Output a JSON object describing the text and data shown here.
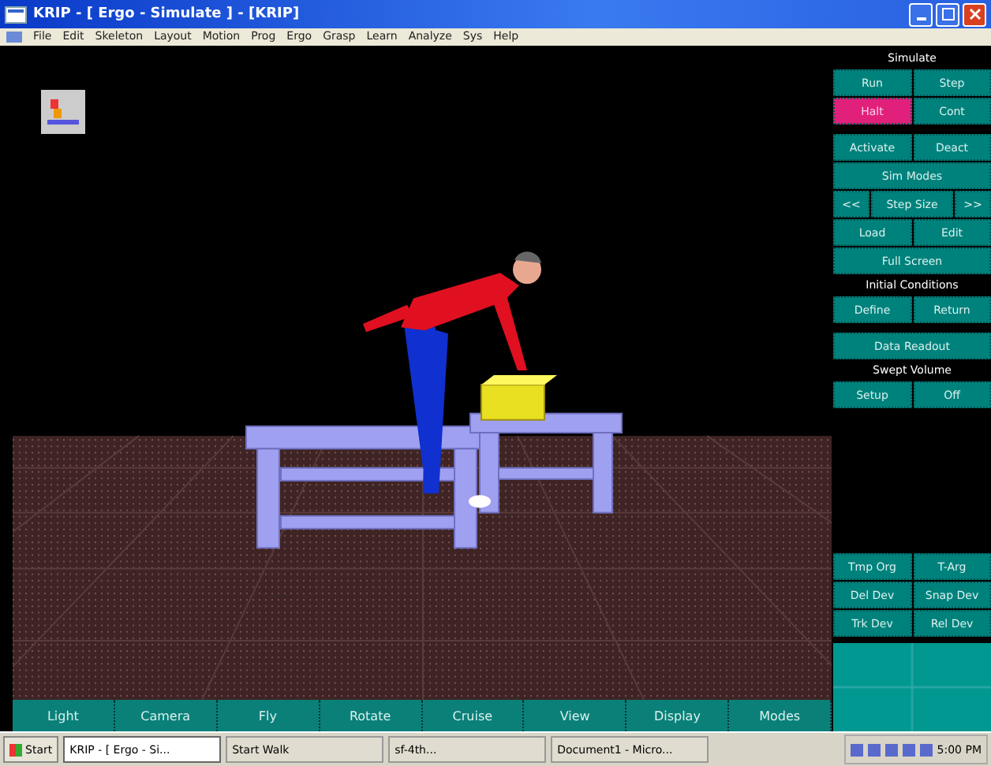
{
  "window": {
    "title": "KRIP - [ Ergo - Simulate ] - [KRIP]"
  },
  "menu": [
    "File",
    "Edit",
    "Skeleton",
    "Layout",
    "Motion",
    "Prog",
    "Ergo",
    "Grasp",
    "Learn",
    "Analyze",
    "Sys",
    "Help"
  ],
  "side_panel": [
    {
      "kind": "header",
      "label": "Simulate"
    },
    {
      "kind": "pair",
      "buttons": [
        {
          "label": "Run",
          "selected": false
        },
        {
          "label": "Step",
          "selected": false
        }
      ]
    },
    {
      "kind": "pair",
      "buttons": [
        {
          "label": "Halt",
          "selected": true
        },
        {
          "label": "Cont",
          "selected": false
        }
      ]
    },
    {
      "kind": "gap"
    },
    {
      "kind": "pair",
      "buttons": [
        {
          "label": "Activate",
          "selected": false
        },
        {
          "label": "Deact",
          "selected": false
        }
      ]
    },
    {
      "kind": "single",
      "buttons": [
        {
          "label": "Sim Modes",
          "selected": false
        }
      ]
    },
    {
      "kind": "stepper",
      "buttons": [
        {
          "label": "<<",
          "selected": false
        },
        {
          "label": "Step Size",
          "selected": false
        },
        {
          "label": ">>",
          "selected": false
        }
      ]
    },
    {
      "kind": "pair",
      "buttons": [
        {
          "label": "Load",
          "selected": false
        },
        {
          "label": "Edit",
          "selected": false
        }
      ]
    },
    {
      "kind": "single",
      "buttons": [
        {
          "label": "Full Screen",
          "selected": false
        }
      ]
    },
    {
      "kind": "header",
      "label": "Initial Conditions"
    },
    {
      "kind": "pair",
      "buttons": [
        {
          "label": "Define",
          "selected": false
        },
        {
          "label": "Return",
          "selected": false
        }
      ]
    },
    {
      "kind": "gap"
    },
    {
      "kind": "single",
      "buttons": [
        {
          "label": "Data Readout",
          "selected": false
        }
      ]
    },
    {
      "kind": "header",
      "label": "Swept Volume"
    },
    {
      "kind": "pair",
      "buttons": [
        {
          "label": "Setup",
          "selected": false
        },
        {
          "label": "Off",
          "selected": false
        }
      ]
    }
  ],
  "device_panel": [
    {
      "kind": "pair",
      "buttons": [
        {
          "label": "Tmp Org",
          "selected": false
        },
        {
          "label": "T-Arg",
          "selected": false
        }
      ]
    },
    {
      "kind": "pair",
      "buttons": [
        {
          "label": "Del Dev",
          "selected": false
        },
        {
          "label": "Snap Dev",
          "selected": false
        }
      ]
    },
    {
      "kind": "pair",
      "buttons": [
        {
          "label": "Trk Dev",
          "selected": false
        },
        {
          "label": "Rel Dev",
          "selected": false
        }
      ]
    }
  ],
  "bottom_toolbar": [
    "Light",
    "Camera",
    "Fly",
    "Rotate",
    "Cruise",
    "View",
    "Display",
    "Modes"
  ],
  "taskbar": {
    "start": "Start",
    "tasks": [
      {
        "label": "KRIP - [ Ergo - Si...",
        "selected": true
      },
      {
        "label": "Start Walk",
        "selected": false
      },
      {
        "label": "sf-4th...",
        "selected": false
      },
      {
        "label": "Document1 - Micro...",
        "selected": false
      }
    ],
    "clock": "5:00 PM"
  }
}
